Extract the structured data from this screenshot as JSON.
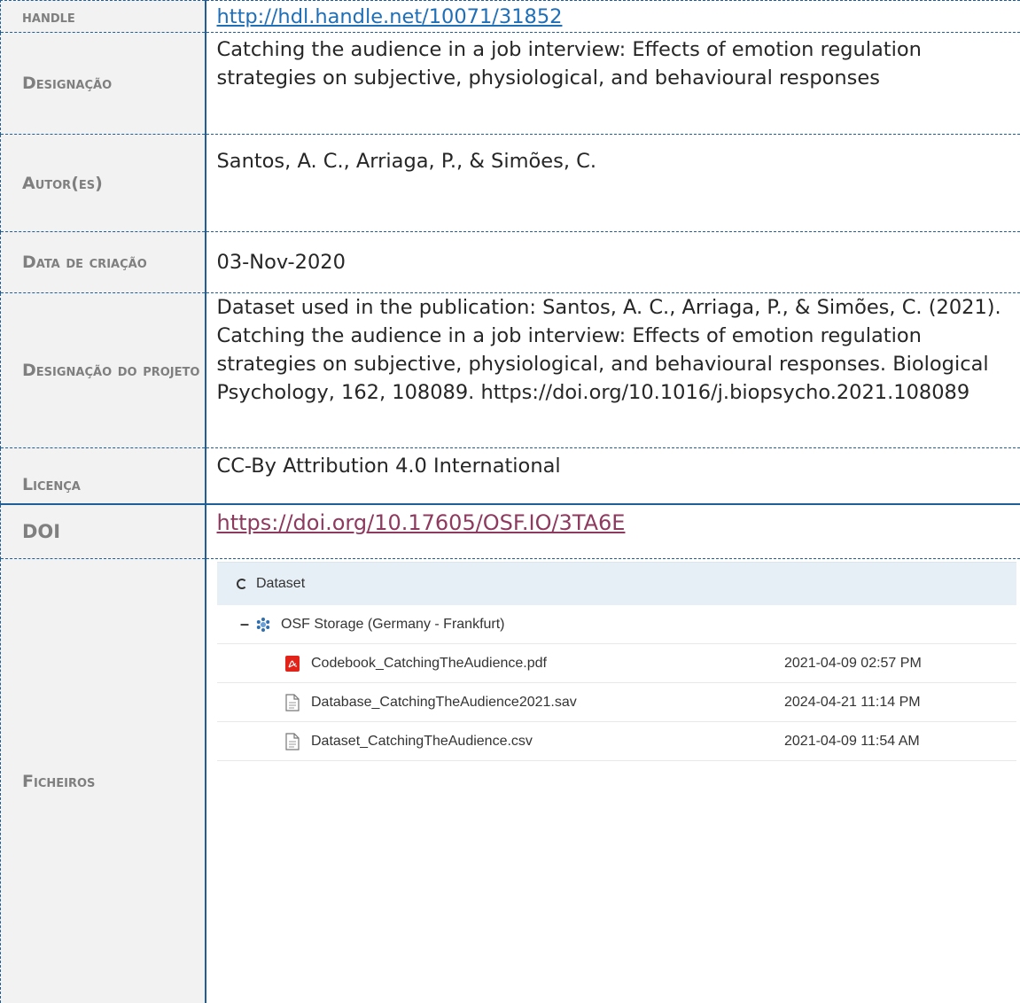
{
  "rows": [
    {
      "label": "handle",
      "value": "http://hdl.handle.net/10071/31852"
    },
    {
      "label": "Designação",
      "value": "Catching the audience in a job interview: Effects of emotion regulation strategies on subjective, physiological, and behavioural responses"
    },
    {
      "label": "Autor(es)",
      "value": "Santos, A. C., Arriaga, P., & Simões, C."
    },
    {
      "label": "Data de criação",
      "value": "03-Nov-2020"
    },
    {
      "label": "Designação do projeto",
      "value": "Dataset used in the publication: Santos, A. C., Arriaga, P., & Simões, C. (2021). Catching the audience in a job interview: Effects of emotion regulation strategies on subjective, physiological, and behavioural responses. Biological Psychology, 162, 108089. https://doi.org/10.1016/j.biopsycho.2021.108089"
    },
    {
      "label": "Licença",
      "value": "CC-By Attribution 4.0 International"
    },
    {
      "label": "DOI",
      "value": "https://doi.org/10.17605/OSF.IO/3TA6E"
    },
    {
      "label": "Ficheiros",
      "value": ""
    }
  ],
  "files_widget": {
    "root_label": "Dataset",
    "provider_label": "OSF Storage (Germany - Frankfurt)",
    "files": [
      {
        "name": "Codebook_CatchingTheAudience.pdf",
        "date": "2021-04-09 02:57 PM",
        "icon": "pdf-icon"
      },
      {
        "name": "Database_CatchingTheAudience2021.sav",
        "date": "2024-04-21 11:14 PM",
        "icon": "file-icon"
      },
      {
        "name": "Dataset_CatchingTheAudience.csv",
        "date": "2021-04-09 11:54 AM",
        "icon": "file-icon"
      }
    ]
  },
  "colors": {
    "border": "#1f5e98",
    "link": "#1f6fb8",
    "doi_link": "#8e3a5f",
    "label": "#7f7f7f"
  }
}
